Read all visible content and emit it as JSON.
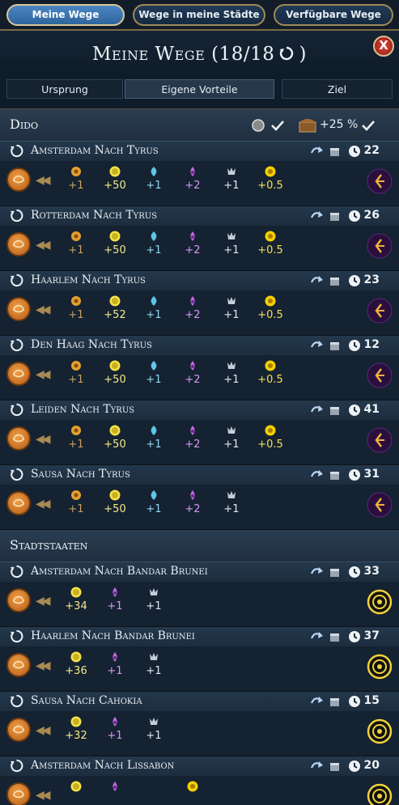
{
  "tabs": [
    "Meine Wege",
    "Wege in meine Städte",
    "Verfügbare Wege"
  ],
  "title": "Meine Wege (18/18",
  "close_label": "X",
  "subtabs": [
    "Ursprung",
    "Eigene Vorteile",
    "Ziel"
  ],
  "groups": [
    {
      "name": "Dido",
      "bonus_text": "+25 %",
      "routes": [
        {
          "name": "Amsterdam Nach Tyrus",
          "turns": "22",
          "yields": [
            "+1",
            "+50",
            "+1",
            "+2",
            "+1",
            "+0.5"
          ]
        },
        {
          "name": "Rotterdam Nach Tyrus",
          "turns": "26",
          "yields": [
            "+1",
            "+50",
            "+1",
            "+2",
            "+1",
            "+0.5"
          ]
        },
        {
          "name": "Haarlem Nach Tyrus",
          "turns": "23",
          "yields": [
            "+1",
            "+52",
            "+1",
            "+2",
            "+1",
            "+0.5"
          ]
        },
        {
          "name": "Den Haag Nach Tyrus",
          "turns": "12",
          "yields": [
            "+1",
            "+50",
            "+1",
            "+2",
            "+1",
            "+0.5"
          ]
        },
        {
          "name": "Leiden Nach Tyrus",
          "turns": "41",
          "yields": [
            "+1",
            "+50",
            "+1",
            "+2",
            "+1",
            "+0.5"
          ]
        },
        {
          "name": "Sausa Nach Tyrus",
          "turns": "31",
          "yields": [
            "+1",
            "+50",
            "+1",
            "+2",
            "+1"
          ]
        }
      ]
    },
    {
      "name": "Stadtstaaten",
      "routes": [
        {
          "name": "Amsterdam Nach Bandar Brunei",
          "turns": "33",
          "yields": [
            "+34",
            "+1",
            "+1"
          ]
        },
        {
          "name": "Haarlem Nach Bandar Brunei",
          "turns": "37",
          "yields": [
            "+36",
            "+1",
            "+1"
          ]
        },
        {
          "name": "Sausa Nach Cahokia",
          "turns": "15",
          "yields": [
            "+32",
            "+1",
            "+1"
          ]
        },
        {
          "name": "Amsterdam Nach Lissabon",
          "turns": "20",
          "yields": []
        }
      ]
    }
  ],
  "colors": {
    "food": "#e2a030",
    "gold": "#f2e24a",
    "science": "#5cc6e8",
    "faith": "#c36ae0",
    "culture": "#c6ccd8",
    "tourism": "#f5d000"
  }
}
